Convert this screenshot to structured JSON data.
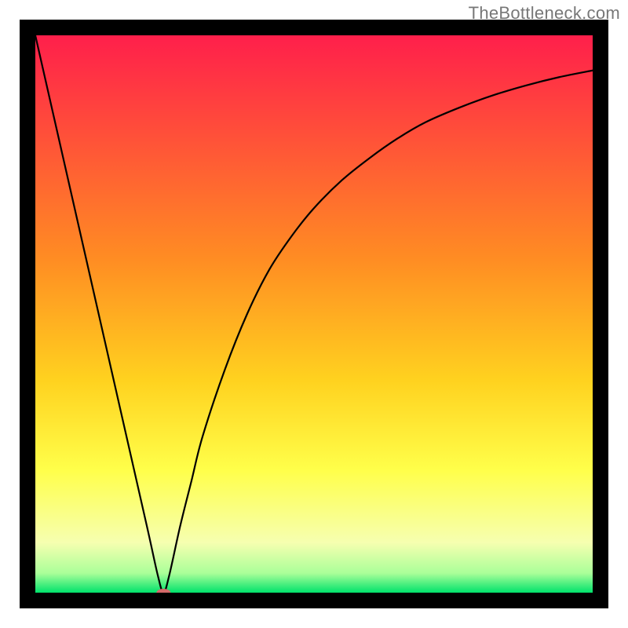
{
  "watermark": "TheBottleneck.com",
  "chart_data": {
    "type": "line",
    "title": "",
    "xlabel": "",
    "ylabel": "",
    "xlim": [
      0,
      100
    ],
    "ylim": [
      0,
      100
    ],
    "gradient_stops": [
      {
        "offset": 0.0,
        "color": "#ff1f4b"
      },
      {
        "offset": 0.4,
        "color": "#ff8c23"
      },
      {
        "offset": 0.62,
        "color": "#ffd21f"
      },
      {
        "offset": 0.78,
        "color": "#ffff4a"
      },
      {
        "offset": 0.91,
        "color": "#f6ffb0"
      },
      {
        "offset": 0.965,
        "color": "#aaff99"
      },
      {
        "offset": 1.0,
        "color": "#00e26b"
      }
    ],
    "series": [
      {
        "name": "bottleneck-curve",
        "x": [
          0,
          5,
          10,
          15,
          20,
          22,
          23,
          24,
          26,
          28,
          30,
          34,
          38,
          42,
          46,
          50,
          55,
          60,
          65,
          70,
          76,
          82,
          88,
          94,
          100
        ],
        "y": [
          100,
          78,
          56,
          34,
          12,
          3,
          0,
          3,
          12,
          20,
          28,
          40,
          50,
          58,
          64,
          69,
          74,
          78,
          81.5,
          84.4,
          87,
          89.2,
          91,
          92.5,
          93.7
        ]
      }
    ],
    "marker": {
      "x": 23,
      "y": 0,
      "rx": 9,
      "ry": 5,
      "color": "#d36a6a"
    }
  }
}
